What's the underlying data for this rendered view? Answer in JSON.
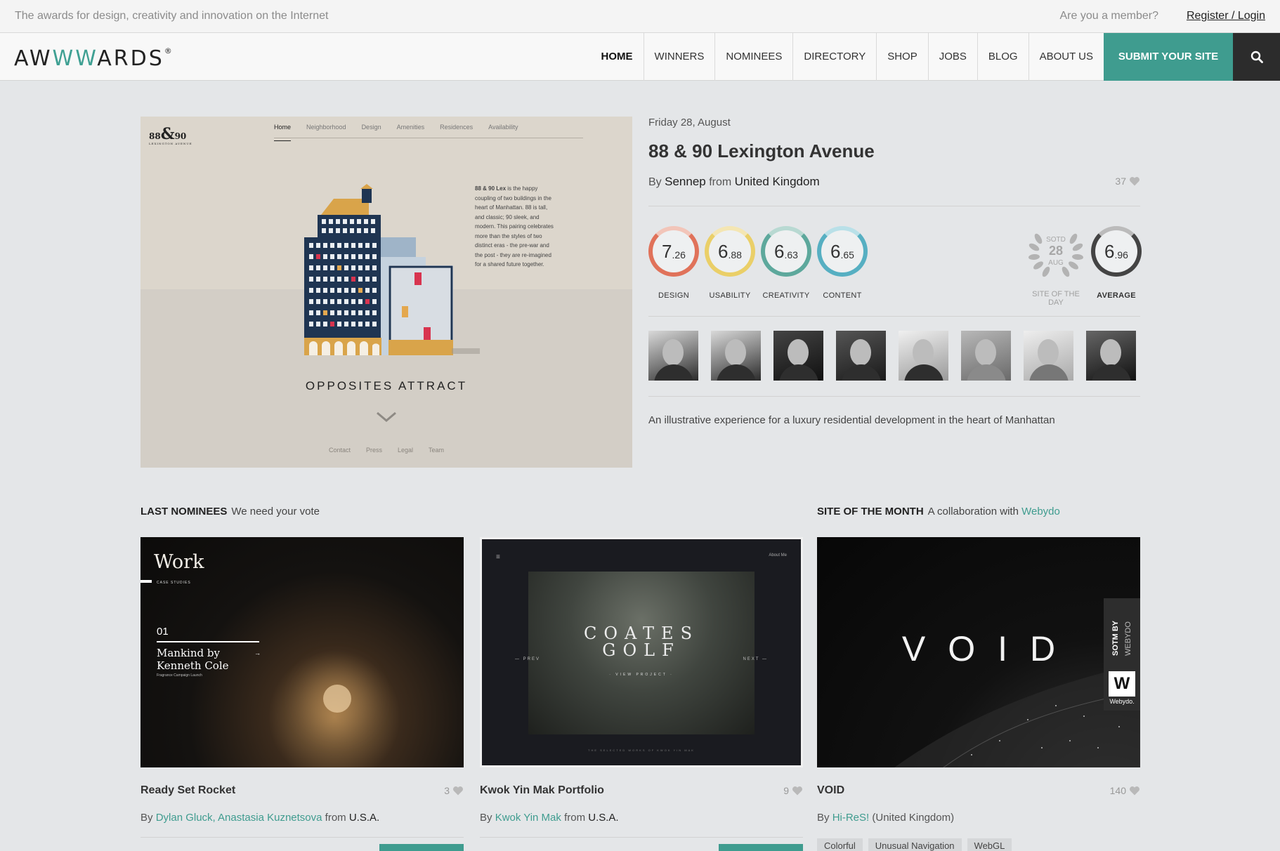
{
  "topbar": {
    "tagline": "The awards for design, creativity and innovation on the Internet",
    "member": "Are you a member?",
    "login": "Register / Login"
  },
  "header": {
    "logo": {
      "pre": "AW",
      "accent": "WW",
      "post": "ARDS",
      "mark": "®"
    },
    "nav": [
      "HOME",
      "WINNERS",
      "NOMINEES",
      "DIRECTORY",
      "SHOP",
      "JOBS",
      "BLOG",
      "ABOUT US"
    ],
    "active": "HOME",
    "submit": "SUBMIT YOUR SITE",
    "search_icon": "search-icon"
  },
  "colors": {
    "accent": "#3f9c8f",
    "dark": "#2c2c2c",
    "design": "#e0725a",
    "usability": "#eacf68",
    "creativity": "#5da89c",
    "content": "#56afc2"
  },
  "featured": {
    "screenshot": {
      "logo_a": "88",
      "logo_amp": "&",
      "logo_b": "90",
      "logo_sub": "LEXINGTON AVENUE",
      "menu": [
        "Home",
        "Neighborhood",
        "Design",
        "Amenities",
        "Residences",
        "Availability"
      ],
      "blurb_bold": "88 & 90 Lex",
      "blurb": " is the happy coupling of two buildings in the heart of Manhattan. 88 is tall, and classic; 90 sleek, and modern. This pairing celebrates more than the styles of two distinct eras - the pre-war and the post - they are re-imagined for a shared future together.",
      "headline": "OPPOSITES ATTRACT",
      "footer": [
        "Contact",
        "Press",
        "Legal",
        "Team"
      ]
    },
    "date": "Friday 28, August",
    "title": "88 & 90 Lexington Avenue",
    "by": "By",
    "author": "Sennep",
    "from": "from",
    "country": "United Kingdom",
    "likes": "37",
    "scores": [
      {
        "key": "design",
        "int": "7",
        "dec": ".26",
        "label": "DESIGN"
      },
      {
        "key": "usability",
        "int": "6",
        "dec": ".88",
        "label": "USABILITY"
      },
      {
        "key": "creativity",
        "int": "6",
        "dec": ".63",
        "label": "CREATIVITY"
      },
      {
        "key": "content",
        "int": "6",
        "dec": ".65",
        "label": "CONTENT"
      }
    ],
    "sotd": {
      "top": "SOTD",
      "day": "28",
      "month": "AUG",
      "label": "SITE OF THE DAY"
    },
    "average": {
      "int": "6",
      "dec": ".96",
      "label": "AVERAGE"
    },
    "jury_count": 8,
    "description": "An illustrative experience for a luxury residential development in the heart of Manhattan"
  },
  "nominees": {
    "title": "LAST NOMINEES",
    "subtitle": "We need your vote",
    "cards": [
      {
        "name": "Ready Set Rocket",
        "count": "3",
        "by": "By",
        "authors": "Dylan Gluck, Anastasia Kuznetsova",
        "from": "from",
        "country": "U.S.A.",
        "thumb": {
          "heading": "Work",
          "sub": "CASE STUDIES",
          "num": "01",
          "title1": "Mankind by",
          "title2": "Kenneth Cole",
          "small": "Fragrance Campaign Launch",
          "arrow": "→"
        }
      },
      {
        "name": "Kwok Yin Mak Portfolio",
        "count": "9",
        "by": "By",
        "authors": "Kwok Yin Mak",
        "from": "from",
        "country": "U.S.A.",
        "thumb": {
          "menu": "≡",
          "about": "About Me",
          "title1": "COATES",
          "title2": "GOLF",
          "view": "· VIEW PROJECT ·",
          "prev": "— PREV",
          "next": "NEXT —",
          "selected": "THE SELECTED WORKS OF KWOK YIN MAK"
        }
      }
    ]
  },
  "sotm": {
    "title": "SITE OF THE MONTH",
    "subtitle": "A collaboration with",
    "partner": "Webydo",
    "card": {
      "name": "VOID",
      "count": "140",
      "by": "By",
      "authors": "Hi-ReS!",
      "country": "(United Kingdom)",
      "thumb": {
        "title": "VOID",
        "badge_bold": "SOTM BY",
        "badge": "WEBYDO",
        "w": "W",
        "wl": "Webydo."
      },
      "tags": [
        "Colorful",
        "Unusual Navigation",
        "WebGL"
      ]
    }
  }
}
